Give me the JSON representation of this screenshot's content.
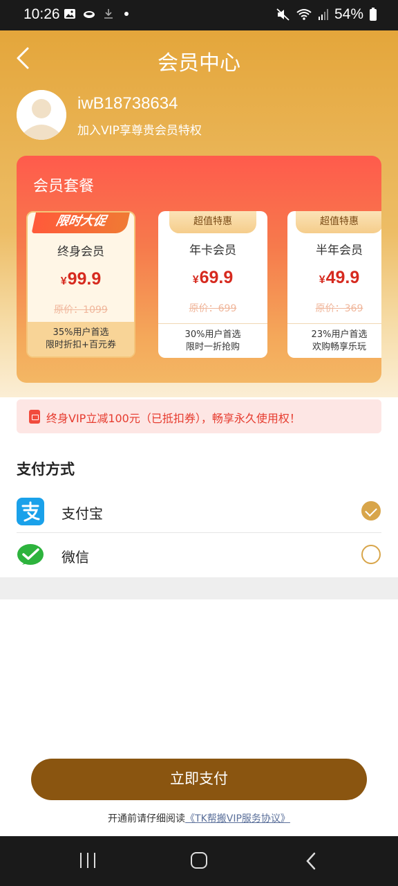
{
  "status_bar": {
    "time": "10:26",
    "battery": "54%"
  },
  "header": {
    "title": "会员中心"
  },
  "user": {
    "name": "iwB18738634",
    "subtitle": "加入VIP享尊贵会员特权"
  },
  "packages": {
    "title": "会员套餐",
    "currency": "¥",
    "items": [
      {
        "badge": "限时大促",
        "name": "终身会员",
        "price": "99.9",
        "original": "原价：1099",
        "foot_line1": "35%用户首选",
        "foot_line2": "限时折扣+百元券",
        "selected": true
      },
      {
        "badge": "超值特惠",
        "name": "年卡会员",
        "price": "69.9",
        "original": "原价：699",
        "foot_line1": "30%用户首选",
        "foot_line2": "限时一折抢购",
        "selected": false
      },
      {
        "badge": "超值特惠",
        "name": "半年会员",
        "price": "49.9",
        "original": "原价：369",
        "foot_line1": "23%用户首选",
        "foot_line2": "欢购畅享乐玩",
        "selected": false
      }
    ]
  },
  "promo": {
    "text": "终身VIP立减100元（已抵扣券），畅享永久使用权！"
  },
  "payment": {
    "title": "支付方式",
    "methods": [
      {
        "label": "支付宝",
        "icon": "alipay-icon",
        "checked": true
      },
      {
        "label": "微信",
        "icon": "wechat-icon",
        "checked": false
      }
    ]
  },
  "pay_button": {
    "label": "立即支付"
  },
  "agreement": {
    "prefix": "开通前请仔细阅读",
    "link": "《TK帮搬VIP服务协议》"
  },
  "colors": {
    "accent": "#d8a54a",
    "button": "#8a5510",
    "price": "#d62a1f",
    "panel_top": "#ff5b4c"
  }
}
